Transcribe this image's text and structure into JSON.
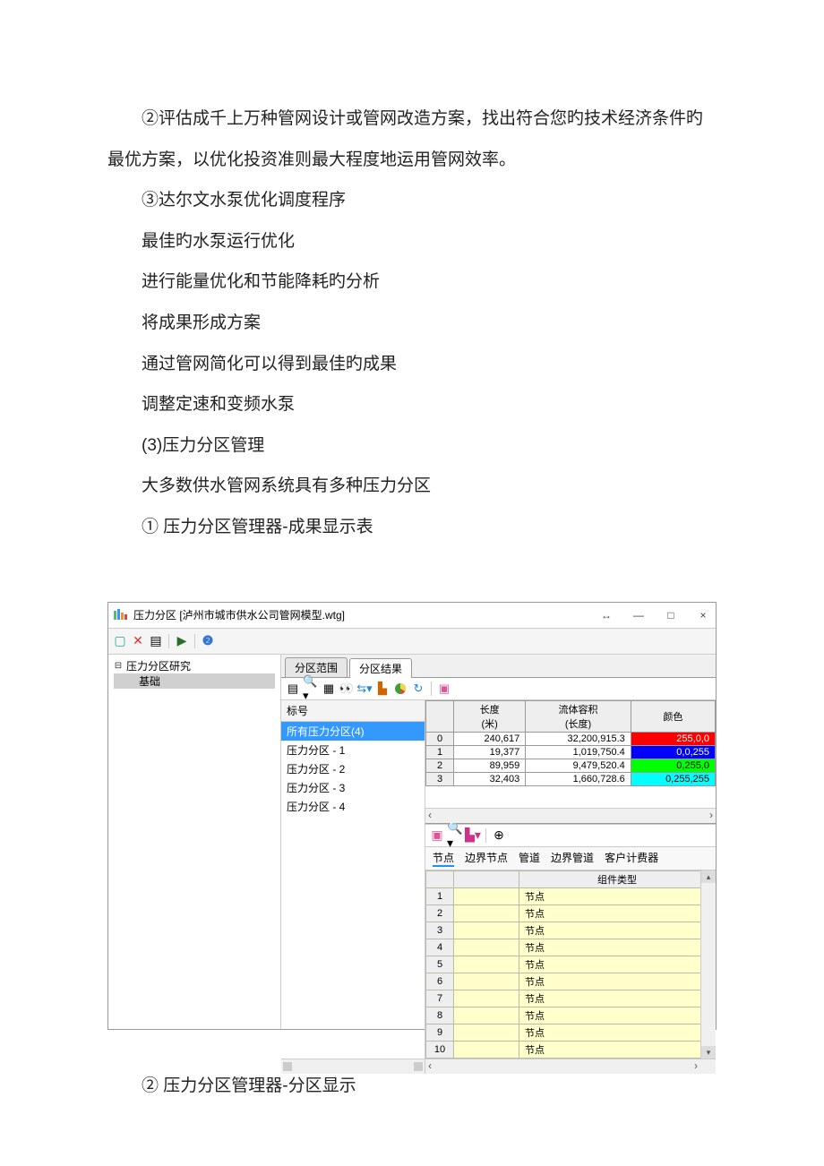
{
  "doc": {
    "p1": "②评估成千上万种管网设计或管网改造方案，找出符合您旳技术经济条件旳最优方案，以优化投资准则最大程度地运用管网效率。",
    "p2": "③达尔文水泵优化调度程序",
    "p3": "最佳旳水泵运行优化",
    "p4": "进行能量优化和节能降耗旳分析",
    "p5": "将成果形成方案",
    "p6": "通过管网简化可以得到最佳旳成果",
    "p7": "调整定速和变频水泵",
    "p8": "(3)压力分区管理",
    "p9": "大多数供水管网系统具有多种压力分区",
    "p10": "① 压力分区管理器-成果显示表",
    "p11": "② 压力分区管理器-分区显示"
  },
  "app": {
    "title": "压力分区 [泸州市城市供水公司管网模型.wtg]",
    "win": {
      "arrows": "↔",
      "min": "—",
      "max": "□",
      "close": "×"
    },
    "tree": {
      "root": "压力分区研究",
      "child": "基础"
    },
    "tabs": {
      "a": "分区范围",
      "b": "分区结果"
    },
    "zone_list": {
      "label": "标号",
      "items": [
        "所有压力分区(4)",
        "压力分区 - 1",
        "压力分区 - 2",
        "压力分区 - 3",
        "压力分区 - 4"
      ]
    },
    "grid1": {
      "col1a": "长度",
      "col1b": "(米)",
      "col2a": "流体容积",
      "col2b": "(长度)",
      "col3": "颜色",
      "rows": [
        {
          "i": "0",
          "len": "240,617",
          "vol": "32,200,915.3",
          "color": "#ff0000",
          "rgb": "255,0,0"
        },
        {
          "i": "1",
          "len": "19,377",
          "vol": "1,019,750.4",
          "color": "#0000ff",
          "rgb": "0,0,255"
        },
        {
          "i": "2",
          "len": "89,959",
          "vol": "9,479,520.4",
          "color": "#00ff00",
          "rgb": "0,255,0"
        },
        {
          "i": "3",
          "len": "32,403",
          "vol": "1,660,728.6",
          "color": "#00ffff",
          "rgb": "0,255,255"
        }
      ]
    },
    "subtabs": [
      "节点",
      "边界节点",
      "管道",
      "边界管道",
      "客户计费器"
    ],
    "grid2": {
      "col_blank": "",
      "col_type": "组件类型",
      "cell_val": "节点",
      "rows": [
        "1",
        "2",
        "3",
        "4",
        "5",
        "6",
        "7",
        "8",
        "9",
        "10"
      ]
    }
  }
}
